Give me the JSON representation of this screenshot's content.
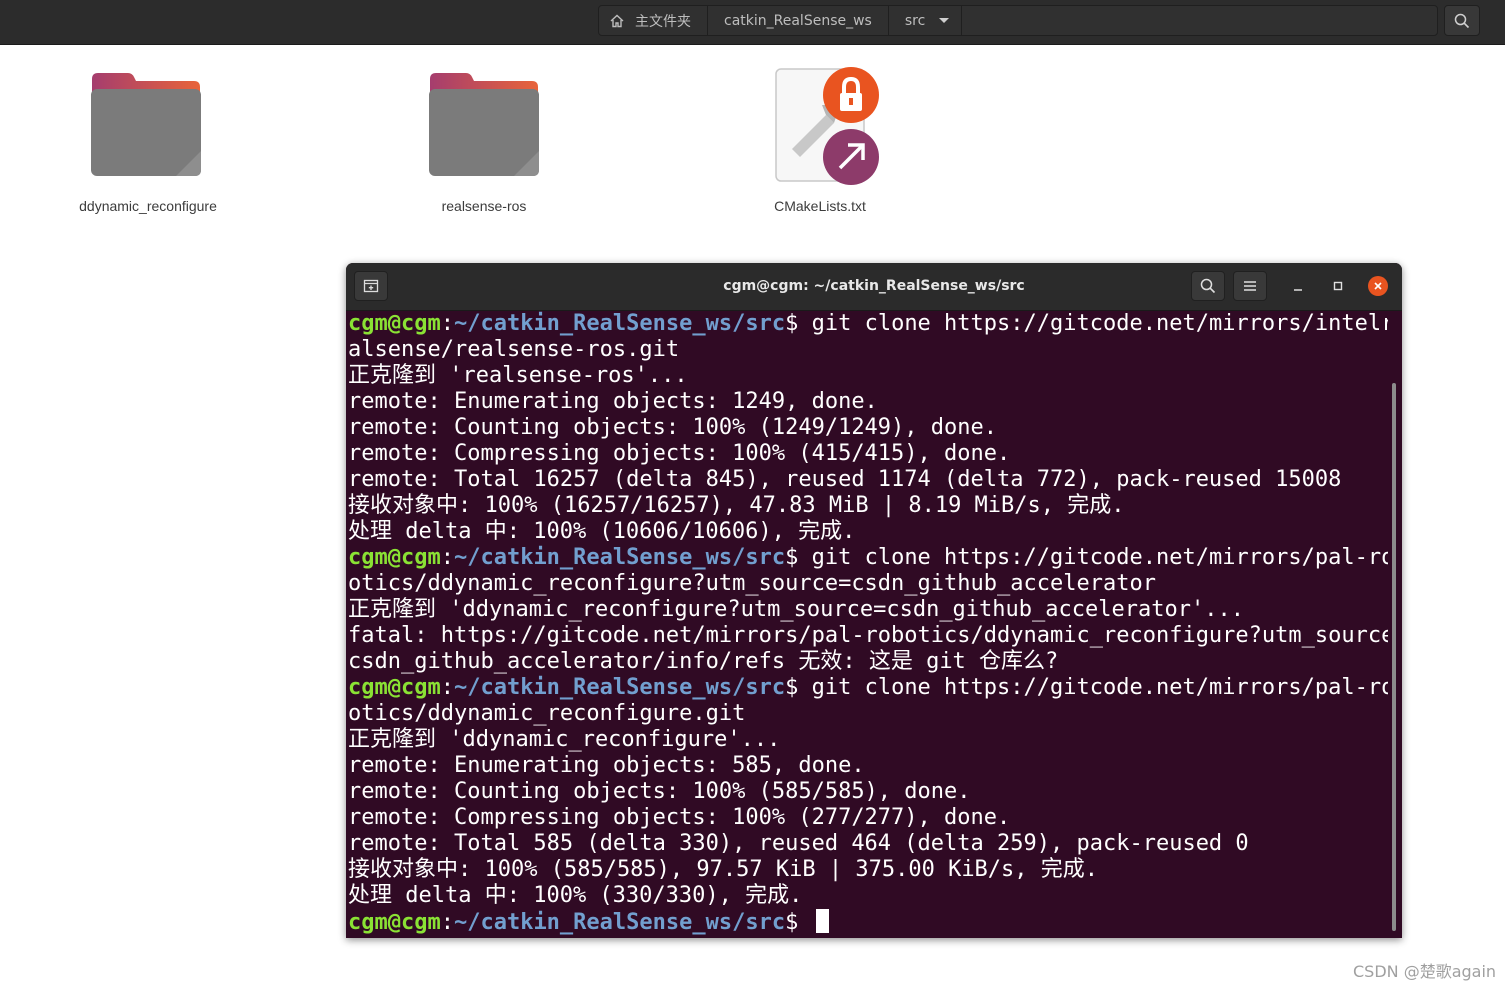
{
  "pathbar": {
    "crumbs": [
      "主文件夹",
      "catkin_RealSense_ws",
      "src"
    ]
  },
  "files": [
    {
      "name": "ddynamic_reconfigure",
      "icon": "folder-icon"
    },
    {
      "name": "realsense-ros",
      "icon": "folder-icon"
    },
    {
      "name": "CMakeLists.txt",
      "icon": "cmake-file-icon"
    }
  ],
  "terminal": {
    "title": "cgm@cgm: ~/catkin_RealSense_ws/src",
    "prompt_user": "cgm@cgm",
    "prompt_path": "~/catkin_RealSense_ws/src",
    "lines": [
      {
        "type": "cmd",
        "text": "$ git clone https://gitcode.net/mirrors/intelre"
      },
      {
        "type": "out",
        "text": "alsense/realsense-ros.git"
      },
      {
        "type": "out",
        "text": "正克隆到 'realsense-ros'..."
      },
      {
        "type": "out",
        "text": "remote: Enumerating objects: 1249, done."
      },
      {
        "type": "out",
        "text": "remote: Counting objects: 100% (1249/1249), done."
      },
      {
        "type": "out",
        "text": "remote: Compressing objects: 100% (415/415), done."
      },
      {
        "type": "out",
        "text": "remote: Total 16257 (delta 845), reused 1174 (delta 772), pack-reused 15008"
      },
      {
        "type": "out",
        "text": "接收对象中: 100% (16257/16257), 47.83 MiB | 8.19 MiB/s, 完成."
      },
      {
        "type": "out",
        "text": "处理 delta 中: 100% (10606/10606), 完成."
      },
      {
        "type": "cmd",
        "text": "$ git clone https://gitcode.net/mirrors/pal-rob"
      },
      {
        "type": "out",
        "text": "otics/ddynamic_reconfigure?utm_source=csdn_github_accelerator"
      },
      {
        "type": "out",
        "text": "正克隆到 'ddynamic_reconfigure?utm_source=csdn_github_accelerator'..."
      },
      {
        "type": "out",
        "text": "fatal: https://gitcode.net/mirrors/pal-robotics/ddynamic_reconfigure?utm_source="
      },
      {
        "type": "out",
        "text": "csdn_github_accelerator/info/refs 无效: 这是 git 仓库么?"
      },
      {
        "type": "cmd",
        "text": "$ git clone https://gitcode.net/mirrors/pal-rob"
      },
      {
        "type": "out",
        "text": "otics/ddynamic_reconfigure.git"
      },
      {
        "type": "out",
        "text": "正克隆到 'ddynamic_reconfigure'..."
      },
      {
        "type": "out",
        "text": "remote: Enumerating objects: 585, done."
      },
      {
        "type": "out",
        "text": "remote: Counting objects: 100% (585/585), done."
      },
      {
        "type": "out",
        "text": "remote: Compressing objects: 100% (277/277), done."
      },
      {
        "type": "out",
        "text": "remote: Total 585 (delta 330), reused 464 (delta 259), pack-reused 0"
      },
      {
        "type": "out",
        "text": "接收对象中: 100% (585/585), 97.57 KiB | 375.00 KiB/s, 完成."
      },
      {
        "type": "out",
        "text": "处理 delta 中: 100% (330/330), 完成."
      },
      {
        "type": "cmd",
        "text": "$ "
      }
    ]
  },
  "watermark": "CSDN @楚歌again",
  "colors": {
    "terminal_bg": "#300a24",
    "prompt_user": "#8ae234",
    "prompt_path": "#729fcf",
    "accent_orange": "#e95420"
  }
}
